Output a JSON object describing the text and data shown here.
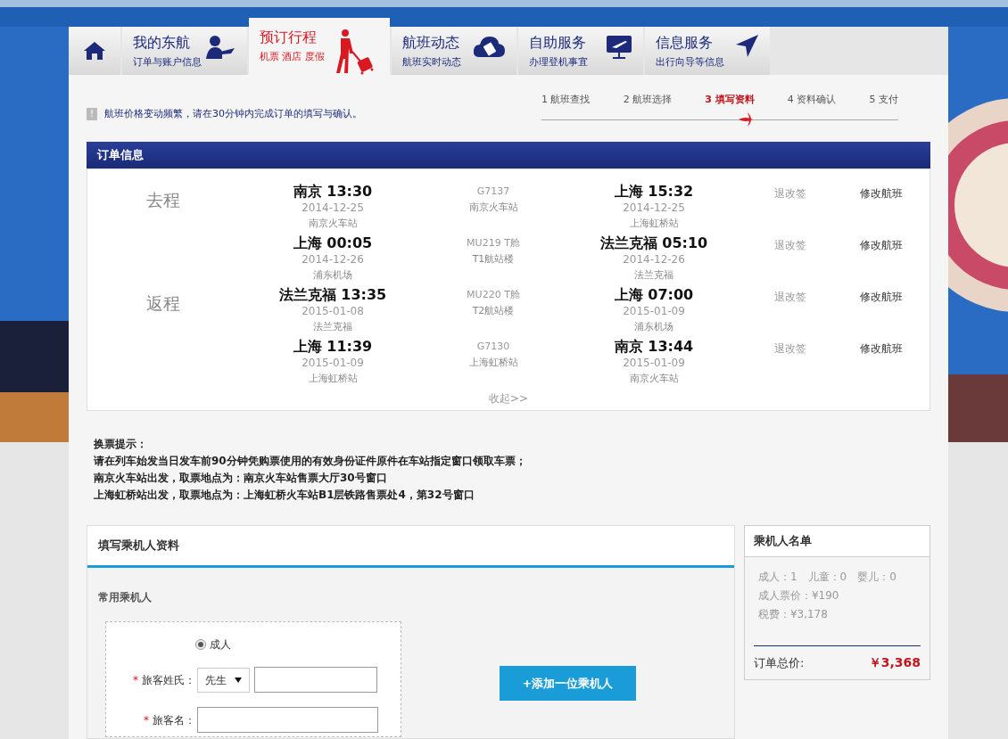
{
  "nav": {
    "tabs": [
      {
        "kind": "home",
        "selected": false
      },
      {
        "kind": "account",
        "title": "我的东航",
        "subtitle": "订单与账户信息",
        "selected": false
      },
      {
        "kind": "booking",
        "title": "预订行程",
        "subtitle": "机票 酒店 度假",
        "selected": true
      },
      {
        "kind": "status",
        "title": "航班动态",
        "subtitle": "航班实时动态",
        "selected": false
      },
      {
        "kind": "checkin",
        "title": "自助服务",
        "subtitle": "办理登机事宜",
        "selected": false
      },
      {
        "kind": "info",
        "title": "信息服务",
        "subtitle": "出行向导等信息",
        "selected": false
      }
    ]
  },
  "notice": {
    "icon": "!",
    "text": "航班价格变动频繁，请在30分钟内完成订单的填写与确认。"
  },
  "steps": [
    {
      "number": "1",
      "label": "航班查找",
      "selected": false
    },
    {
      "number": "2",
      "label": "航班选择",
      "selected": false
    },
    {
      "number": "3",
      "label": "填写资料",
      "selected": true
    },
    {
      "number": "4",
      "label": "资料确认",
      "selected": false
    },
    {
      "number": "5",
      "label": "支付",
      "selected": false
    }
  ],
  "order": {
    "title": "订单信息",
    "trips": [
      {
        "label": "去程",
        "segments": [
          {
            "dep": {
              "place_time": "南京 13:30",
              "date": "2014-12-25",
              "station": "南京火车站"
            },
            "mid": {
              "flight": "G7137",
              "terminal": "南京火车站"
            },
            "arr": {
              "place_time": "上海 15:32",
              "date": "2014-12-25",
              "station": "上海虹桥站"
            },
            "change": "退改签",
            "modify": "修改航班"
          },
          {
            "dep": {
              "place_time": "上海 00:05",
              "date": "2014-12-26",
              "station": "浦东机场"
            },
            "mid": {
              "flight": "MU219 T舱",
              "terminal": "T1航站楼"
            },
            "arr": {
              "place_time": "法兰克福 05:10",
              "date": "2014-12-26",
              "station": "法兰克福"
            },
            "change": "退改签",
            "modify": "修改航班"
          }
        ]
      },
      {
        "label": "返程",
        "segments": [
          {
            "dep": {
              "place_time": "法兰克福 13:35",
              "date": "2015-01-08",
              "station": "法兰克福"
            },
            "mid": {
              "flight": "MU220 T舱",
              "terminal": "T2航站楼"
            },
            "arr": {
              "place_time": "上海 07:00",
              "date": "2015-01-09",
              "station": "浦东机场"
            },
            "change": "退改签",
            "modify": "修改航班"
          },
          {
            "dep": {
              "place_time": "上海 11:39",
              "date": "2015-01-09",
              "station": "上海虹桥站"
            },
            "mid": {
              "flight": "G7130",
              "terminal": "上海虹桥站"
            },
            "arr": {
              "place_time": "南京 13:44",
              "date": "2015-01-09",
              "station": "南京火车站"
            },
            "change": "退改签",
            "modify": "修改航班"
          }
        ]
      }
    ],
    "collapse": "收起>>"
  },
  "ticket_tips": [
    "换票提示：",
    "请在列车始发当日发车前90分钟凭购票使用的有效身份证件原件在车站指定窗口领取车票；",
    "南京火车站出发，取票地点为：南京火车站售票大厅30号窗口",
    "上海虹桥站出发，取票地点为：上海虹桥火车站B1层铁路售票处4，第32号窗口"
  ],
  "passenger_form": {
    "title": "填写乘机人资料",
    "frequent_label": "常用乘机人",
    "type_radio": {
      "label": "成人",
      "checked": true
    },
    "fields": [
      {
        "required": "*",
        "label": "旅客姓氏：",
        "select": "先生"
      },
      {
        "required": "*",
        "label": "旅客名："
      }
    ],
    "add_button": "+添加一位乘机人"
  },
  "passenger_list": {
    "title": "乘机人名单",
    "counts": [
      "成人：1",
      "儿童：0",
      "婴儿：0"
    ],
    "fare": "成人票价：¥190",
    "tax": "税费：¥3,178",
    "total_label": "订单总价:",
    "total": "￥3,368"
  }
}
